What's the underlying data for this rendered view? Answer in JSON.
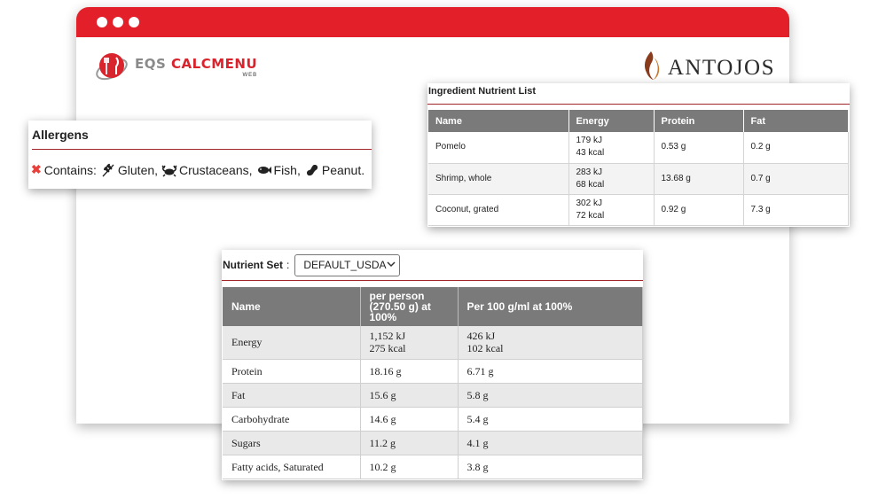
{
  "app": {
    "logo_left_part1": "EQS ",
    "logo_left_part2": "CALCMENU",
    "logo_left_sub": "WEB",
    "logo_right": "ANTOJOS"
  },
  "allergens": {
    "title": "Allergens",
    "contains_label": "Contains:",
    "items": [
      {
        "label": "Gluten,",
        "icon": "wheat-icon"
      },
      {
        "label": "Crustaceans,",
        "icon": "crab-icon"
      },
      {
        "label": "Fish,",
        "icon": "fish-icon"
      },
      {
        "label": "Peanut.",
        "icon": "peanut-icon"
      }
    ]
  },
  "ingredients": {
    "title": "Ingredient Nutrient List",
    "columns": [
      "Name",
      "Energy",
      "Protein",
      "Fat"
    ],
    "rows": [
      {
        "name": "Pomelo",
        "energy_kj": "179 kJ",
        "energy_kcal": "43 kcal",
        "protein": "0.53 g",
        "fat": "0.2 g"
      },
      {
        "name": "Shrimp, whole",
        "energy_kj": "283 kJ",
        "energy_kcal": "68 kcal",
        "protein": "13.68 g",
        "fat": "0.7 g"
      },
      {
        "name": "Coconut, grated",
        "energy_kj": "302 kJ",
        "energy_kcal": "72 kcal",
        "protein": "0.92 g",
        "fat": "7.3 g"
      }
    ]
  },
  "nutrients": {
    "label": "Nutrient Set",
    "colon": ":",
    "selected": "DEFAULT_USDA",
    "columns": [
      "Name",
      "per person (270.50 g) at 100%",
      "Per 100 g/ml at 100%"
    ],
    "rows": [
      {
        "name": "Energy",
        "per_person": "1,152 kJ",
        "per_person_2": "275 kcal",
        "per_100": "426 kJ",
        "per_100_2": "102 kcal"
      },
      {
        "name": "Protein",
        "per_person": "18.16 g",
        "per_100": "6.71 g"
      },
      {
        "name": "Fat",
        "per_person": "15.6 g",
        "per_100": "5.8 g"
      },
      {
        "name": "Carbohydrate",
        "per_person": "14.6 g",
        "per_100": "5.4 g"
      },
      {
        "name": "Sugars",
        "per_person": "11.2 g",
        "per_100": "4.1 g"
      },
      {
        "name": "Fatty acids, Saturated",
        "per_person": "10.2 g",
        "per_100": "3.8 g"
      }
    ]
  },
  "colors": {
    "accent": "#e3202a",
    "rule": "#a0262a",
    "table_header": "#7a7a7a"
  }
}
